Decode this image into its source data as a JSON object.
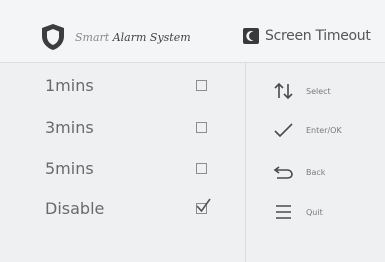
{
  "header": {
    "brand_prefix": "Smart ",
    "brand_main": "Alarm System",
    "brand_logo_icon": "shield-icon",
    "title": "Screen Timeout",
    "title_icon": "moon-icon"
  },
  "options": [
    {
      "label": "1mins",
      "checked": false
    },
    {
      "label": "3mins",
      "checked": false
    },
    {
      "label": "5mins",
      "checked": false
    },
    {
      "label": "Disable",
      "checked": true
    }
  ],
  "help": [
    {
      "icon": "up-down-arrows-icon",
      "label": "Select"
    },
    {
      "icon": "checkmark-icon",
      "label": "Enter/OK"
    },
    {
      "icon": "back-arrow-icon",
      "label": "Back"
    },
    {
      "icon": "menu-icon",
      "label": "Quit"
    }
  ],
  "colors": {
    "background": "#eef0f2",
    "header_background": "#f4f5f6",
    "text": "#6a6a6a",
    "icon": "#555555"
  }
}
